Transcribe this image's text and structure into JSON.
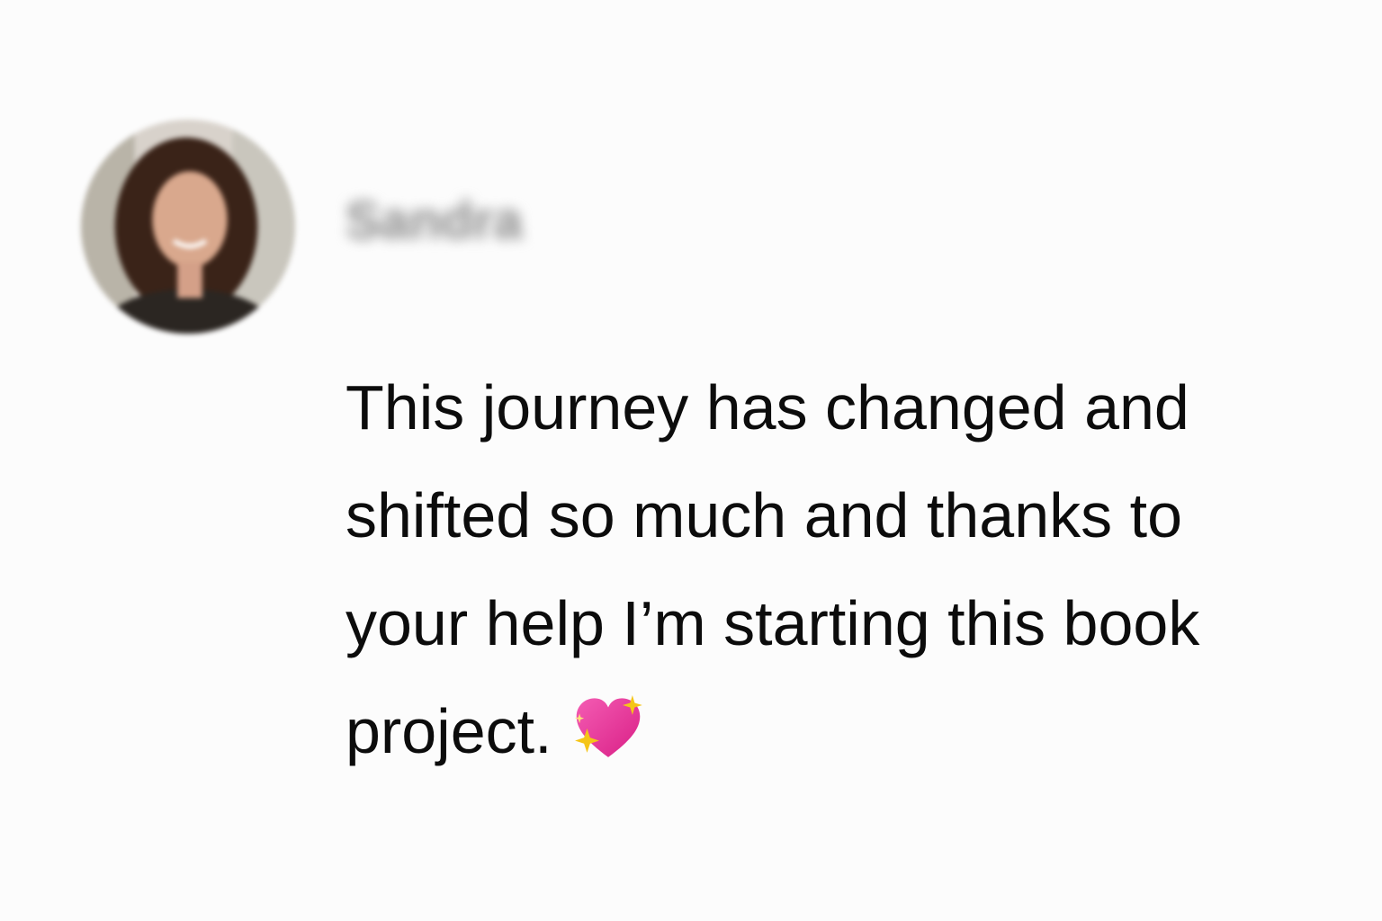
{
  "author": {
    "name": "Sandra"
  },
  "message": {
    "lines": [
      "This journey has changed and",
      "shifted so much and thanks to",
      "your help I’m starting this book",
      "project."
    ],
    "emoji": "sparkling-heart-icon"
  },
  "colors": {
    "background": "#fcfcfc",
    "text": "#0c0c0c",
    "author": "#8a8a8a",
    "heart": "#e8349a",
    "sparkle": "#f5c518"
  }
}
